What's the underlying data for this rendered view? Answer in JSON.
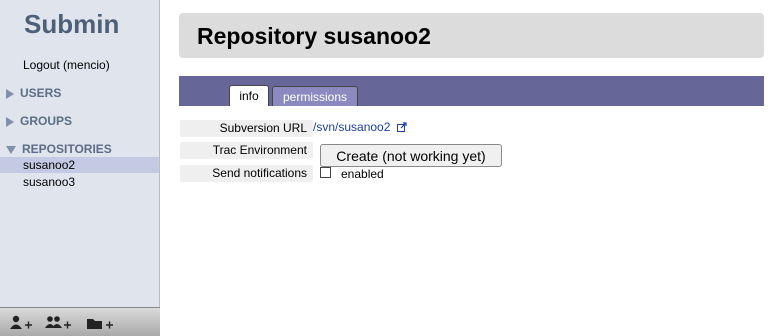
{
  "sidebar": {
    "brand": "Submin",
    "logout": "Logout (mencio)",
    "sections": {
      "users": "USERS",
      "groups": "GROUPS",
      "repositories": "REPOSITORIES"
    },
    "repositories": [
      "susanoo2",
      "susanoo3"
    ],
    "selected_repository": "susanoo2",
    "toolbar": {
      "icons": [
        "add-user-icon",
        "add-group-icon",
        "add-repository-icon"
      ]
    }
  },
  "main": {
    "title": "Repository susanoo2",
    "tabs": {
      "info": "info",
      "permissions": "permissions"
    },
    "active_tab": "info",
    "fields": {
      "subversion_url_label": "Subversion URL",
      "subversion_url_value": "/svn/susanoo2",
      "trac_label": "Trac Environment",
      "trac_button": "Create (not working yet)",
      "notifications_label": "Send notifications",
      "notifications_option": "enabled",
      "notifications_checked": false
    }
  },
  "colors": {
    "tabbar": "#666699",
    "sidebar": "#e0e4ec",
    "brand": "#4e5f78",
    "link": "#1f3fa8"
  }
}
